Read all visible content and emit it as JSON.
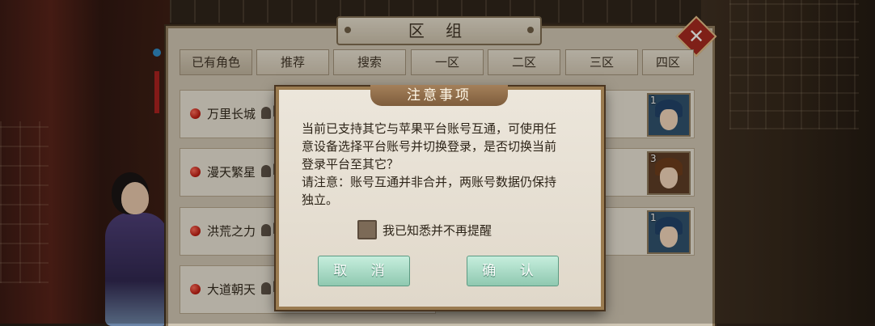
{
  "panel": {
    "title": "区 组",
    "close_label": "✕",
    "tabs": [
      "已有角色",
      "推荐",
      "搜索",
      "一区",
      "二区",
      "三区",
      "四区"
    ],
    "servers": [
      {
        "name": "万里长城",
        "bracket": "[",
        "avatar_level": "1"
      },
      {
        "name": "漫天繁星",
        "bracket": "[",
        "avatar_level": "3"
      },
      {
        "name": "洪荒之力",
        "bracket": "[",
        "avatar_level": "1"
      },
      {
        "name": "大道朝天",
        "bracket": "[",
        "avatar_level": ""
      }
    ]
  },
  "dialog": {
    "title": "注意事项",
    "line1": "当前已支持其它与苹果平台账号互通，可使用任",
    "line2": "意设备选择平台账号并切换登录，是否切换当前",
    "line3": "登录平台至其它？",
    "line4": "请注意：账号互通并非合并，两账号数据仍保持",
    "line5": "独立。",
    "checkbox_label": "我已知悉并不再提醒",
    "cancel_label": "取 消",
    "confirm_label": "确 认"
  }
}
